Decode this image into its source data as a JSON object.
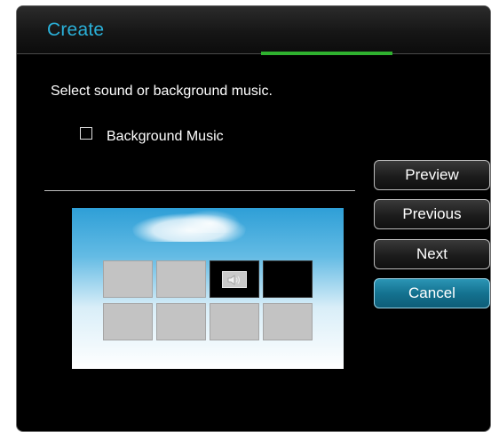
{
  "dialog": {
    "title": "Create",
    "title_color": "#2ab0d8",
    "progress_color": "#2fb12f",
    "instruction": "Select sound or background music.",
    "checkbox": {
      "label": "Background Music",
      "checked": false
    },
    "buttons": [
      {
        "label": "Preview",
        "active": false
      },
      {
        "label": "Previous",
        "active": false
      },
      {
        "label": "Next",
        "active": false
      },
      {
        "label": "Cancel",
        "active": true
      }
    ],
    "accent_button_color": "#147290",
    "preview": {
      "rows": 2,
      "cols": 4,
      "cells": [
        "empty",
        "empty",
        "sound",
        "dark",
        "empty",
        "empty",
        "empty",
        "empty"
      ],
      "sound_icon": "speaker-icon"
    }
  }
}
